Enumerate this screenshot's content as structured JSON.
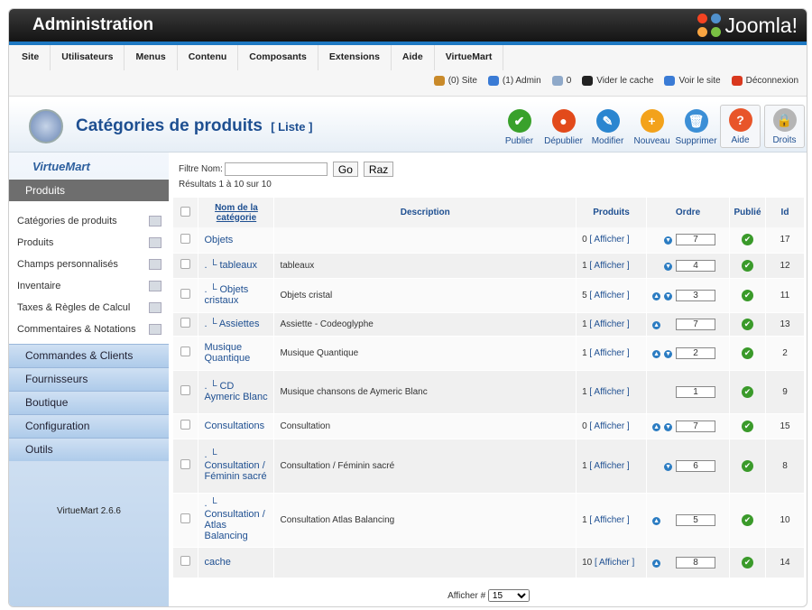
{
  "header": {
    "title": "Administration",
    "logo_text": "Joomla!"
  },
  "menu": [
    "Site",
    "Utilisateurs",
    "Menus",
    "Contenu",
    "Composants",
    "Extensions",
    "Aide",
    "VirtueMart"
  ],
  "status": [
    {
      "icon": "users-icon",
      "text": "(0) Site",
      "color": "#c98a2a"
    },
    {
      "icon": "admin-icon",
      "text": "(1) Admin",
      "color": "#3a7bd5"
    },
    {
      "icon": "messages-icon",
      "text": "0",
      "color": "#8fa9c9"
    },
    {
      "icon": "clear-cache-icon",
      "text": "Vider le cache",
      "color": "#222"
    },
    {
      "icon": "view-site-icon",
      "text": "Voir le site",
      "color": "#3a7bd5"
    },
    {
      "icon": "logout-icon",
      "text": "Déconnexion",
      "color": "#d9381e"
    }
  ],
  "page": {
    "title": "Catégories de produits",
    "subtitle": "[ Liste ]"
  },
  "toolbar": [
    {
      "name": "publish",
      "label": "Publier",
      "color": "#39a12b",
      "glyph": "✔"
    },
    {
      "name": "unpublish",
      "label": "Dépublier",
      "color": "#e24a1b",
      "glyph": "●"
    },
    {
      "name": "edit",
      "label": "Modifier",
      "color": "#2b86d0",
      "glyph": "✎"
    },
    {
      "name": "new",
      "label": "Nouveau",
      "color": "#f3a21b",
      "glyph": "+"
    },
    {
      "name": "delete",
      "label": "Supprimer",
      "color": "#3c8fd6",
      "glyph": "🗑"
    },
    {
      "name": "help",
      "label": "Aide",
      "color": "#e8552a",
      "glyph": "?"
    },
    {
      "name": "rights",
      "label": "Droits",
      "color": "#b5b5b5",
      "glyph": "🔒"
    }
  ],
  "sidebar": {
    "brand": "VirtueMart",
    "section": "Produits",
    "items": [
      "Catégories de produits",
      "Produits",
      "Champs personnalisés",
      "Inventaire",
      "Taxes & Règles de Calcul",
      "Commentaires & Notations"
    ],
    "sections": [
      "Commandes & Clients",
      "Fournisseurs",
      "Boutique",
      "Configuration",
      "Outils"
    ],
    "version": "VirtueMart 2.6.6"
  },
  "filter": {
    "label": "Filtre Nom:",
    "value": "",
    "go": "Go",
    "reset": "Raz",
    "results": "Résultats 1 à 10 sur 10"
  },
  "table": {
    "headers": {
      "name": "Nom de la catégorie",
      "description": "Description",
      "products": "Produits",
      "order": "Ordre",
      "published": "Publié",
      "id": "Id"
    },
    "rows": [
      {
        "name": "Objets",
        "prefix": "",
        "description": "",
        "count": "0",
        "link": "[ Afficher ]",
        "up": false,
        "down": true,
        "order": "7",
        "id": "17"
      },
      {
        "name": "tableaux",
        "prefix": ". └ ",
        "description": "tableaux",
        "count": "1",
        "link": "[ Afficher ]",
        "up": false,
        "down": true,
        "order": "4",
        "id": "12"
      },
      {
        "name": "Objets cristaux",
        "prefix": ". └ ",
        "description": "Objets cristal",
        "count": "5",
        "link": "[ Afficher ]",
        "up": true,
        "down": true,
        "order": "3",
        "id": "11"
      },
      {
        "name": "Assiettes",
        "prefix": ". └ ",
        "description": "Assiette - Codeoglyphe",
        "count": "1",
        "link": "[ Afficher ]",
        "up": true,
        "down": false,
        "order": "7",
        "id": "13"
      },
      {
        "name": "Musique Quantique",
        "prefix": "",
        "description": "Musique Quantique",
        "count": "1",
        "link": "[ Afficher ]",
        "up": true,
        "down": true,
        "order": "2",
        "id": "2"
      },
      {
        "name": "CD Aymeric Blanc",
        "prefix": ". └ ",
        "description": "Musique chansons de Aymeric Blanc",
        "count": "1",
        "link": "[ Afficher ]",
        "up": false,
        "down": false,
        "order": "1",
        "id": "9"
      },
      {
        "name": "Consultations",
        "prefix": "",
        "description": "Consultation",
        "count": "0",
        "link": "[ Afficher ]",
        "up": true,
        "down": true,
        "order": "7",
        "id": "15"
      },
      {
        "name": "Consultation / Féminin sacré",
        "prefix": ". └ ",
        "description": "Consultation / Féminin sacré",
        "count": "1",
        "link": "[ Afficher ]",
        "up": false,
        "down": true,
        "order": "6",
        "id": "8"
      },
      {
        "name": "Consultation / Atlas Balancing",
        "prefix": ". └ ",
        "description": "Consultation Atlas Balancing",
        "count": "1",
        "link": "[ Afficher ]",
        "up": true,
        "down": false,
        "order": "5",
        "id": "10"
      },
      {
        "name": "cache",
        "prefix": "",
        "description": "",
        "count": "10",
        "link": "[ Afficher ]",
        "up": true,
        "down": false,
        "order": "8",
        "id": "14"
      }
    ]
  },
  "pager": {
    "label": "Afficher #",
    "value": "15"
  }
}
